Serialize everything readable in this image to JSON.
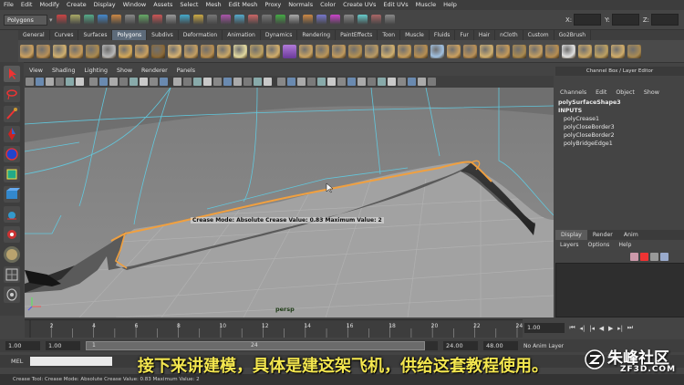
{
  "menubar": [
    "File",
    "Edit",
    "Modify",
    "Create",
    "Display",
    "Window",
    "Assets",
    "Select",
    "Mesh",
    "Edit Mesh",
    "Proxy",
    "Normals",
    "Color",
    "Create UVs",
    "Edit UVs",
    "Muscle",
    "Help"
  ],
  "statusline": {
    "mode_dropdown": "Polygons",
    "x_label": "X:",
    "y_label": "Y:",
    "z_label": "Z:"
  },
  "shelf_tabs": [
    "General",
    "Curves",
    "Surfaces",
    "Polygons",
    "Subdivs",
    "Deformation",
    "Animation",
    "Dynamics",
    "Rendering",
    "PaintEffects",
    "Toon",
    "Muscle",
    "Fluids",
    "Fur",
    "Hair",
    "nCloth",
    "Custom",
    "Go2Brush"
  ],
  "shelf_active": "Polygons",
  "viewport": {
    "menu": [
      "View",
      "Shading",
      "Lighting",
      "Show",
      "Renderer",
      "Panels"
    ],
    "hud_text": "Crease Mode: Absolute   Crease Value:  0.83   Maximum Value: 2",
    "camera_label": "persp"
  },
  "channel_box": {
    "title": "Channel Box / Layer Editor",
    "menu": [
      "Channels",
      "Edit",
      "Object",
      "Show"
    ],
    "shape_name": "polySurfaceShape3",
    "inputs_label": "INPUTS",
    "inputs": [
      "polyCrease1",
      "polyCloseBorder3",
      "polyCloseBorder2",
      "polyBridgeEdge1"
    ]
  },
  "layer_editor": {
    "tabs": [
      "Display",
      "Render",
      "Anim"
    ],
    "active_tab": "Display",
    "menu": [
      "Layers",
      "Options",
      "Help"
    ]
  },
  "timeline": {
    "ticks": [
      "2",
      "4",
      "6",
      "8",
      "10",
      "12",
      "14",
      "16",
      "18",
      "20",
      "22",
      "24"
    ],
    "current_frame": "1.00"
  },
  "range": {
    "start": "1.00",
    "start_inner": "1.00",
    "slider_start": "1",
    "slider_end": "24",
    "end_inner": "24.00",
    "end": "48.00",
    "anim_layer": "No Anim Layer"
  },
  "mel_label": "MEL",
  "help_line": "Crease Tool: Crease Mode: Absolute  Crease Value: 0.83  Maximum Value: 2",
  "subtitle": "接下来讲建模，具体是建这架飞机，供给这套教程使用。",
  "watermark": {
    "name": "朱峰社区",
    "url": "ZF3D.COM"
  },
  "colors": {
    "accent_orange": "#f0a040",
    "wire_blue": "#5fd0e8",
    "subtitle_yellow": "#f3e64f"
  }
}
